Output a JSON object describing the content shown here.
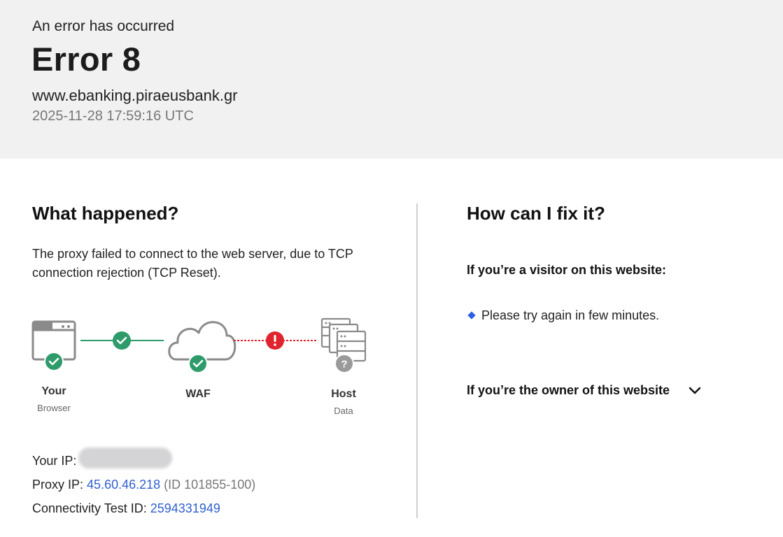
{
  "header": {
    "subtitle": "An error has occurred",
    "title": "Error 8",
    "domain": "www.ebanking.piraeusbank.gr",
    "timestamp": "2025-11-28 17:59:16 UTC"
  },
  "left": {
    "heading": "What happened?",
    "description": "The proxy failed to connect to the web server, due to TCP connection rejection (TCP Reset).",
    "diagram": {
      "nodes": [
        {
          "label": "Your",
          "sub": "Browser",
          "status": "ok"
        },
        {
          "label": "WAF",
          "sub": "",
          "status": "ok"
        },
        {
          "label": "Host",
          "sub": "Data",
          "status": "unknown"
        }
      ],
      "links": [
        {
          "status": "ok"
        },
        {
          "status": "error"
        }
      ]
    },
    "your_ip_label": "Your IP:",
    "proxy_ip_label": "Proxy IP:",
    "proxy_ip": "45.60.46.218",
    "proxy_id": "(ID 101855-100)",
    "test_id_label": "Connectivity Test ID:",
    "test_id": "2594331949"
  },
  "right": {
    "heading": "How can I fix it?",
    "visitor_heading": "If you’re a visitor on this website:",
    "visitor_tip": "Please try again in few minutes.",
    "owner_heading": "If you’re the owner of this website"
  },
  "colors": {
    "ok": "#2e9b6a",
    "error": "#e0242f",
    "unknown": "#9a9a9a",
    "link": "#2f5fcf",
    "bullet": "#2d5fe0"
  }
}
